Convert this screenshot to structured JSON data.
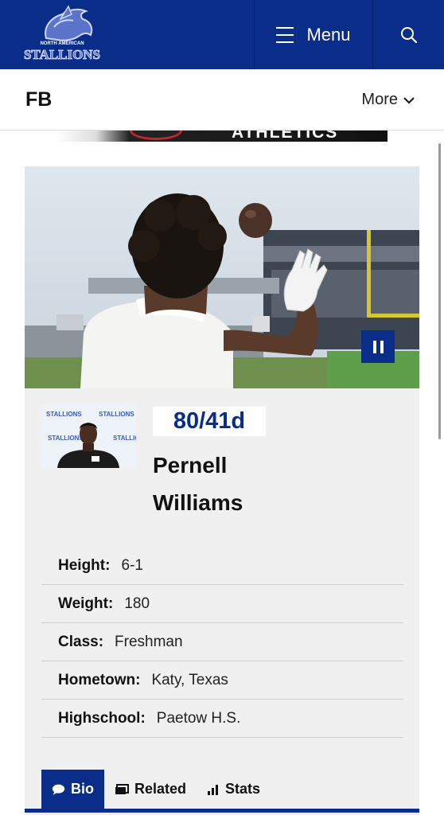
{
  "header": {
    "logo_top": "NORTH AMERICAN",
    "logo_main": "STALLIONS",
    "menu_label": "Menu",
    "brand_color": "#0a2d8a"
  },
  "subnav": {
    "sport": "FB",
    "more_label": "More"
  },
  "banner": {
    "text": "ATHLETICS"
  },
  "player": {
    "number_label": "80/41d",
    "first_name": "Pernell",
    "last_name": "Williams",
    "headshot_backdrop": "STALLIONS",
    "facts": [
      {
        "label": "Height:",
        "value": "6-1"
      },
      {
        "label": "Weight:",
        "value": "180"
      },
      {
        "label": "Class:",
        "value": "Freshman"
      },
      {
        "label": "Hometown:",
        "value": "Katy, Texas"
      },
      {
        "label": "Highschool:",
        "value": "Paetow H.S."
      }
    ]
  },
  "tabs": [
    {
      "label": "Bio",
      "icon": "chat-bubble-icon",
      "active": true
    },
    {
      "label": "Related",
      "icon": "gallery-icon",
      "active": false
    },
    {
      "label": "Stats",
      "icon": "bar-chart-icon",
      "active": false
    }
  ]
}
